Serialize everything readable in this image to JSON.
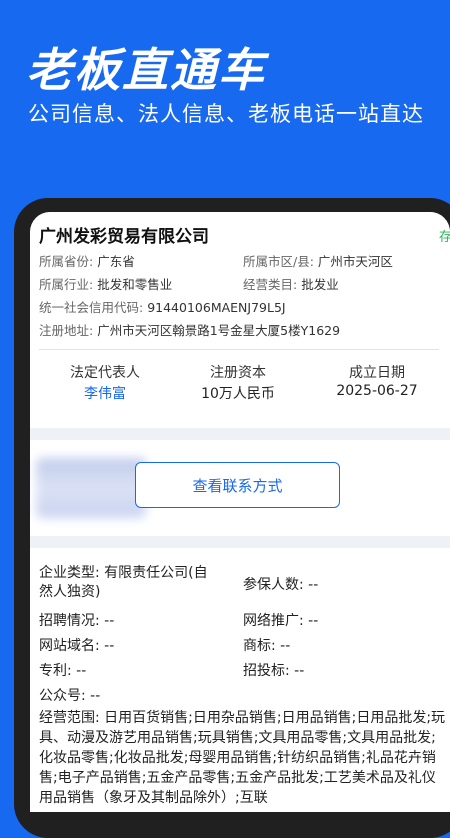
{
  "hero": {
    "title": "老板直通车",
    "subtitle": "公司信息、法人信息、老板电话一站直达"
  },
  "company": {
    "name": "广州发彩贸易有限公司",
    "side_tag": "存",
    "province_label": "所属省份:",
    "province": "广东省",
    "district_label": "所属市区/县:",
    "district": "广州市天河区",
    "industry_label": "所属行业:",
    "industry": "批发和零售业",
    "category_label": "经营类目:",
    "category": "批发业",
    "credit_code_label": "统一社会信用代码:",
    "credit_code": "91440106MAENJ79L5J",
    "address_label": "注册地址:",
    "address": "广州市天河区翰景路1号金星大厦5楼Y1629"
  },
  "stats": {
    "legal_rep_label": "法定代表人",
    "legal_rep": "李伟富",
    "capital_label": "注册资本",
    "capital": "10万人民币",
    "founded_label": "成立日期",
    "founded": "2025-06-27"
  },
  "contact": {
    "button_label": "查看联系方式"
  },
  "details": {
    "type_label": "企业类型:",
    "type_line1": "有限责任公司(自",
    "type_line2": "然人独资)",
    "insured_label": "参保人数:",
    "insured": "--",
    "recruit_label": "招聘情况:",
    "recruit": "--",
    "promo_label": "网络推广:",
    "promo": "--",
    "domain_label": "网站域名:",
    "domain": "--",
    "trademark_label": "商标:",
    "trademark": "--",
    "patent_label": "专利:",
    "patent": "--",
    "bid_label": "招投标:",
    "bid": "--",
    "wechat_label": "公众号:",
    "wechat": "--",
    "scope_label": "经营范围:",
    "scope": "日用百货销售;日用杂品销售;日用品销售;日用品批发;玩具、动漫及游艺用品销售;玩具销售;文具用品零售;文具用品批发;化妆品零售;化妆品批发;母婴用品销售;针纺织品销售;礼品花卉销售;电子产品销售;五金产品零售;五金产品批发;工艺美术品及礼仪用品销售（象牙及其制品除外）;互联"
  }
}
